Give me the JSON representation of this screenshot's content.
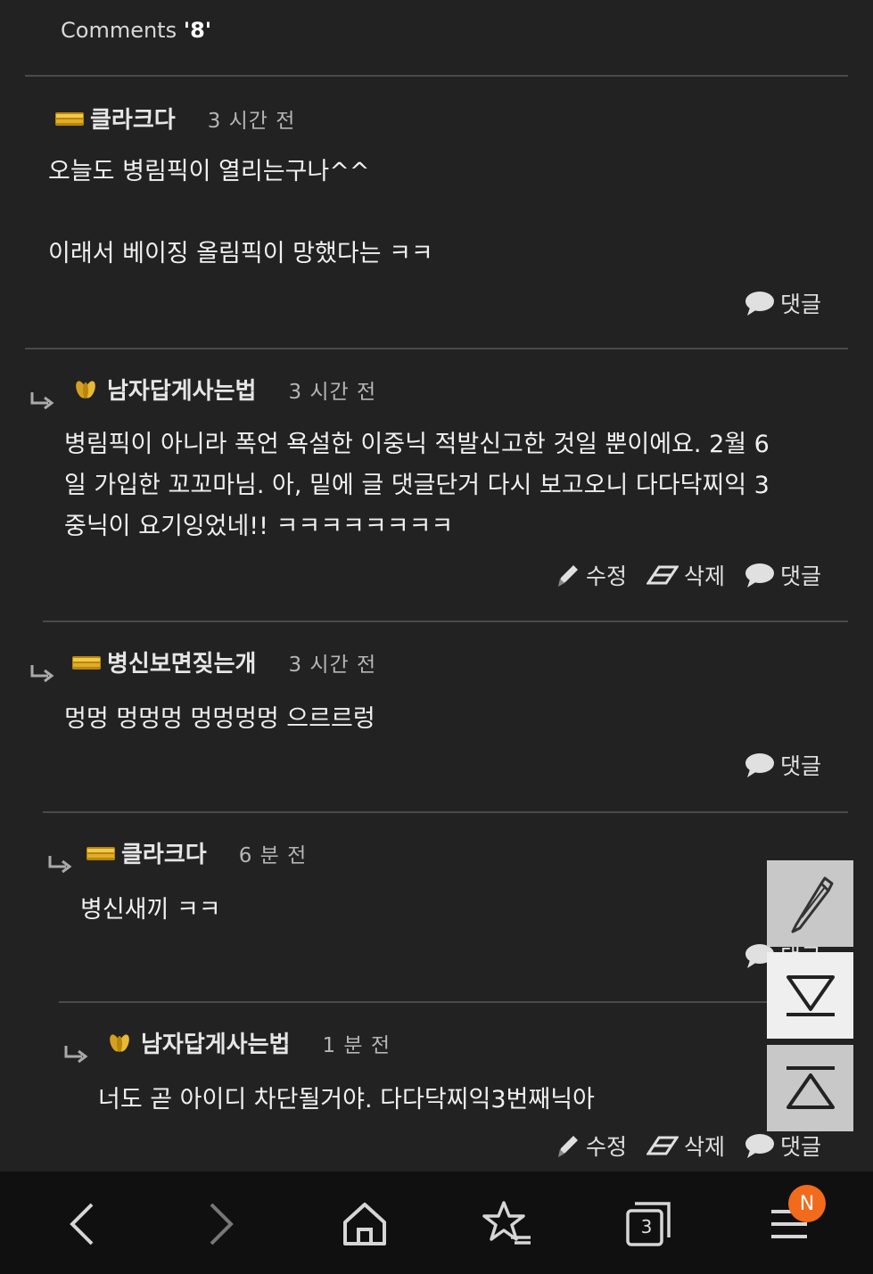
{
  "header": {
    "label": "Comments ",
    "count": "'8'"
  },
  "comments": [
    {
      "author": "클라크다",
      "badge": "gold-bar",
      "time": "3 시간 전",
      "text": "오늘도 병림픽이 열리는구나^^\n\n이래서 베이징 올림픽이 망했다는 ㅋㅋ",
      "actions": {
        "reply": "댓글"
      }
    },
    {
      "author": "남자답게사는법",
      "badge": "gold-wheat",
      "time": "3 시간 전",
      "text": "병림픽이 아니라 폭언 욕설한 이중닉 적발신고한 것일 뿐이에요. 2월 6\n일 가입한 꼬꼬마님. 아, 밑에 글 댓글단거 다시 보고오니 다다닥찌익 3\n중닉이 요기잉었네!! ㅋㅋㅋㅋㅋㅋㅋㅋ",
      "actions": {
        "edit": "수정",
        "delete": "삭제",
        "reply": "댓글"
      }
    },
    {
      "author": "병신보면짖는개",
      "badge": "gold-bar",
      "time": "3 시간 전",
      "text": "멍멍 멍멍멍 멍멍멍멍 으르르렁",
      "actions": {
        "reply": "댓글"
      }
    },
    {
      "author": "클라크다",
      "badge": "gold-bar",
      "time": "6 분 전",
      "text": "병신새끼 ㅋㅋ",
      "actions": {
        "reply": "댓글"
      }
    },
    {
      "author": "남자답게사는법",
      "badge": "gold-wheat",
      "time": "1 분 전",
      "text": "너도 곧 아이디 차단될거야. 다다닥찌익3번째닉아",
      "actions": {
        "edit": "수정",
        "delete": "삭제",
        "reply": "댓글"
      }
    }
  ],
  "floating_buttons": [
    "pencil-icon",
    "scroll-down-icon",
    "scroll-up-icon"
  ],
  "bottom_bar": {
    "tabs_count": "3",
    "notification": "N"
  },
  "colors": {
    "background": "#222222",
    "divider": "#4a4a4a",
    "badge_gold": "#d4a021",
    "notification": "#f26a1b",
    "bar": "#101010"
  }
}
